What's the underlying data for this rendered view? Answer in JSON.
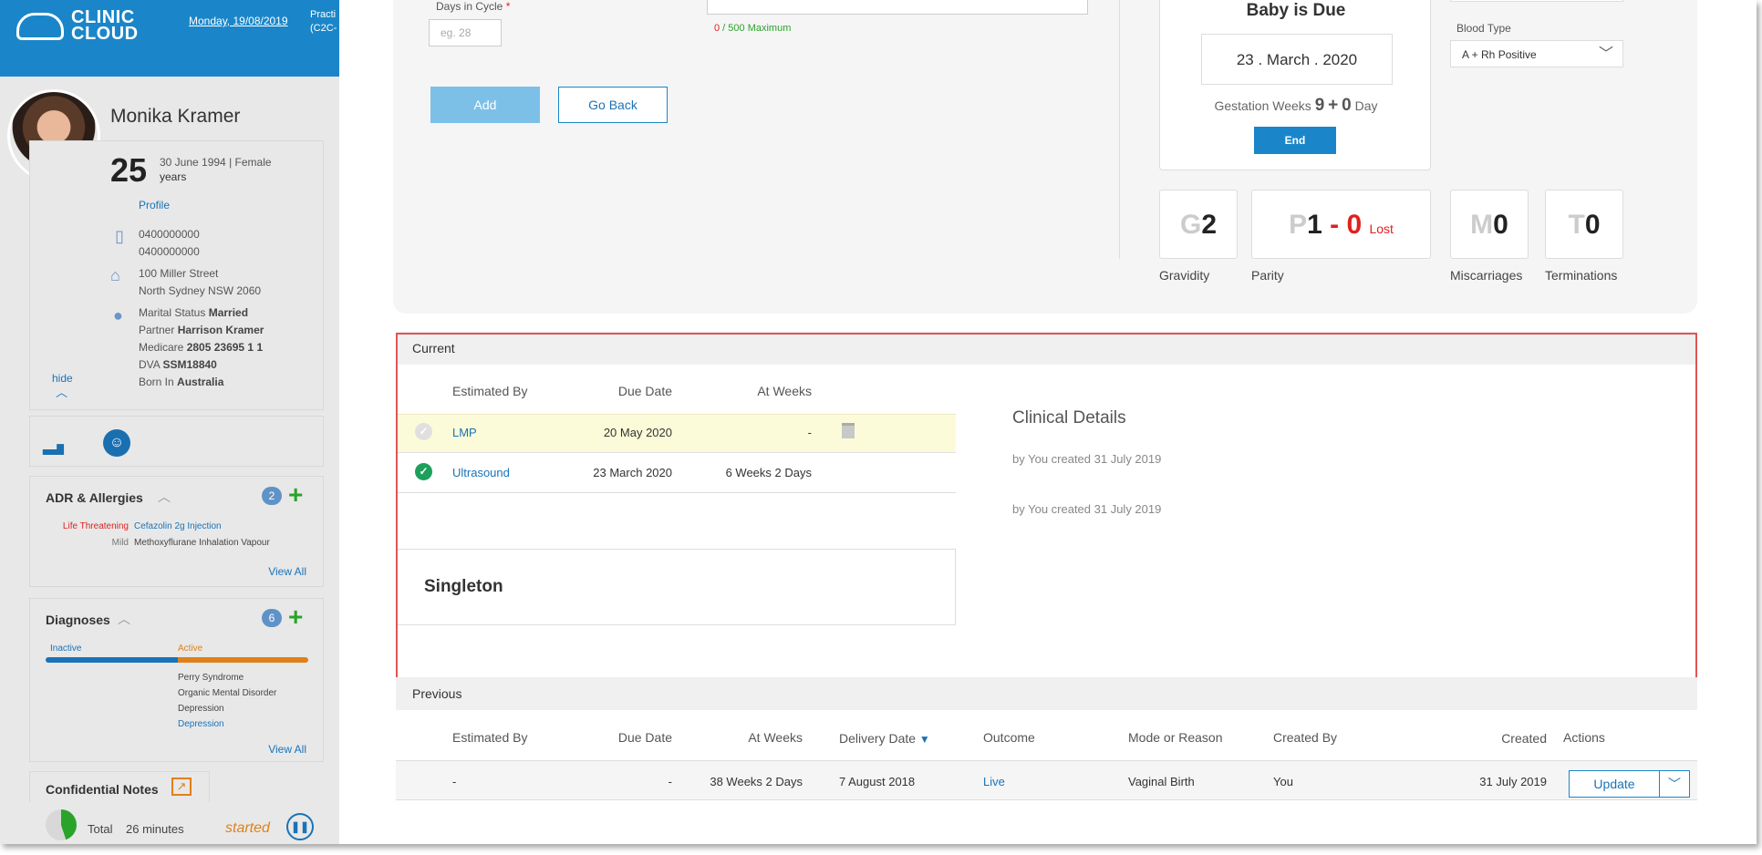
{
  "header": {
    "logo_text": "CLINIC\nCLOUD",
    "date": "Monday, 19/08/2019",
    "practice_text": "Practi\n(C2C-"
  },
  "patient": {
    "name": "Monika Kramer",
    "age": "25",
    "age_unit": "years",
    "dob_gender": "30 June 1994 | Female",
    "profile_link": "Profile",
    "phone1": "0400000000",
    "phone2": "0400000000",
    "address1": "100 Miller Street",
    "address2": "North Sydney NSW 2060",
    "marital_label": "Marital Status",
    "marital_value": "Married",
    "partner_label": "Partner",
    "partner_value": "Harrison Kramer",
    "medicare_label": "Medicare",
    "medicare_value": "2805 23695 1 1",
    "dva_label": "DVA",
    "dva_value": "SSM18840",
    "born_label": "Born In",
    "born_value": "Australia",
    "hide_label": "hide"
  },
  "allergies": {
    "title": "ADR & Allergies",
    "count": "2",
    "items": [
      {
        "severity": "Life Threatening",
        "name": "Cefazolin 2g Injection"
      },
      {
        "severity": "Mild",
        "name": "Methoxyflurane Inhalation Vapour"
      }
    ],
    "view_all": "View All"
  },
  "diagnoses": {
    "title": "Diagnoses",
    "count": "6",
    "inactive_label": "Inactive",
    "active_label": "Active",
    "items": [
      "Perry Syndrome",
      "Organic Mental Disorder",
      "Depression",
      "Depression"
    ],
    "view_all": "View All"
  },
  "notes": {
    "title": "Confidential Notes"
  },
  "timer": {
    "total_label": "Total",
    "duration": "26 minutes",
    "status": "started"
  },
  "form": {
    "days_label": "Days in Cycle",
    "required_mark": "*",
    "days_placeholder": "eg. 28",
    "counter_used": "0",
    "counter_max": " / 500 Maximum",
    "add_button": "Add",
    "back_button": "Go Back"
  },
  "due": {
    "title": "Baby is Due",
    "date": "23 . March . 2020",
    "gest_label": "Gestation Weeks",
    "gest_weeks": "9",
    "plus": "+",
    "gest_days": "0",
    "day_label": "Day",
    "end_button": "End"
  },
  "blood": {
    "label": "Blood Type",
    "value": "A + Rh Positive"
  },
  "counts": {
    "g_letter": "G",
    "g_value": "2",
    "g_caption": "Gravidity",
    "p_letter": "P",
    "p_value": "1",
    "p_dash": " - ",
    "p_lost": "0",
    "p_lost_label": "Lost",
    "p_caption": "Parity",
    "m_letter": "M",
    "m_value": "0",
    "m_caption": "Miscarriages",
    "t_letter": "T",
    "t_value": "0",
    "t_caption": "Terminations"
  },
  "current": {
    "header": "Current",
    "columns": [
      "Estimated By",
      "Due Date",
      "At Weeks"
    ],
    "rows": [
      {
        "by": "LMP",
        "due": "20 May 2020",
        "weeks": "-"
      },
      {
        "by": "Ultrasound",
        "due": "23 March 2020",
        "weeks": "6 Weeks 2 Days"
      }
    ],
    "singleton": "Singleton",
    "clinical_title": "Clinical Details",
    "clinical_lines": [
      "by You created 31 July 2019",
      "by You created 31 July 2019"
    ]
  },
  "previous": {
    "header": "Previous",
    "columns": [
      "Estimated By",
      "Due Date",
      "At Weeks",
      "Delivery Date",
      "Outcome",
      "Mode or Reason",
      "Created By",
      "Created",
      "Actions"
    ],
    "row": {
      "by": "-",
      "due": "-",
      "weeks": "38 Weeks 2 Days",
      "delivery": "7 August 2018",
      "outcome": "Live",
      "mode": "Vaginal Birth",
      "created_by": "You",
      "created": "31 July 2019"
    },
    "update_button": "Update"
  },
  "colors": {
    "brand": "#1a86c9",
    "highlight_row": "#fcfbd9",
    "selection_border": "#e05555",
    "lost_red": "#e02020",
    "check_green": "#1ea05a"
  }
}
